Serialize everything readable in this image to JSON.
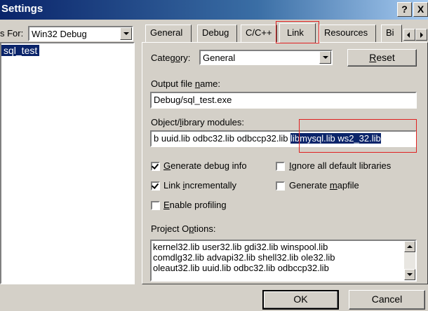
{
  "window": {
    "title": "Settings",
    "help_glyph": "?",
    "close_glyph": "X"
  },
  "left": {
    "settings_for_label": "s For:",
    "settings_for_value": "Win32 Debug",
    "tree_item": "sql_test"
  },
  "tabs": [
    {
      "label": "General"
    },
    {
      "label": "Debug"
    },
    {
      "label": "C/C++"
    },
    {
      "label": "Link"
    },
    {
      "label": "Resources"
    },
    {
      "label": "Bi"
    }
  ],
  "link_page": {
    "category_label": "Category:",
    "category_value": "General",
    "reset_label": "Reset",
    "output_label": "Output file name:",
    "output_value": "Debug/sql_test.exe",
    "modules_label": "Object/library modules:",
    "modules_value_plain": "b uuid.lib odbc32.lib odbccp32.lib ",
    "modules_value_selected": "libmysql.lib ws2_32.lib",
    "checkboxes": [
      {
        "label": "Generate debug info",
        "checked": true
      },
      {
        "label": "Ignore all default libraries",
        "checked": false
      },
      {
        "label": "Link incrementally",
        "checked": true
      },
      {
        "label": "Generate mapfile",
        "checked": false
      },
      {
        "label": "Enable profiling",
        "checked": false
      }
    ],
    "options_label": "Project Options:",
    "options_lines": [
      "kernel32.lib user32.lib gdi32.lib winspool.lib",
      "comdlg32.lib advapi32.lib shell32.lib ole32.lib",
      "oleaut32.lib uuid.lib odbc32.lib odbccp32.lib"
    ]
  },
  "footer": {
    "ok_label": "OK",
    "cancel_label": "Cancel"
  },
  "colors": {
    "face": "#d4d0c8",
    "selection": "#0a246a",
    "annotation_red": "#e02020"
  }
}
